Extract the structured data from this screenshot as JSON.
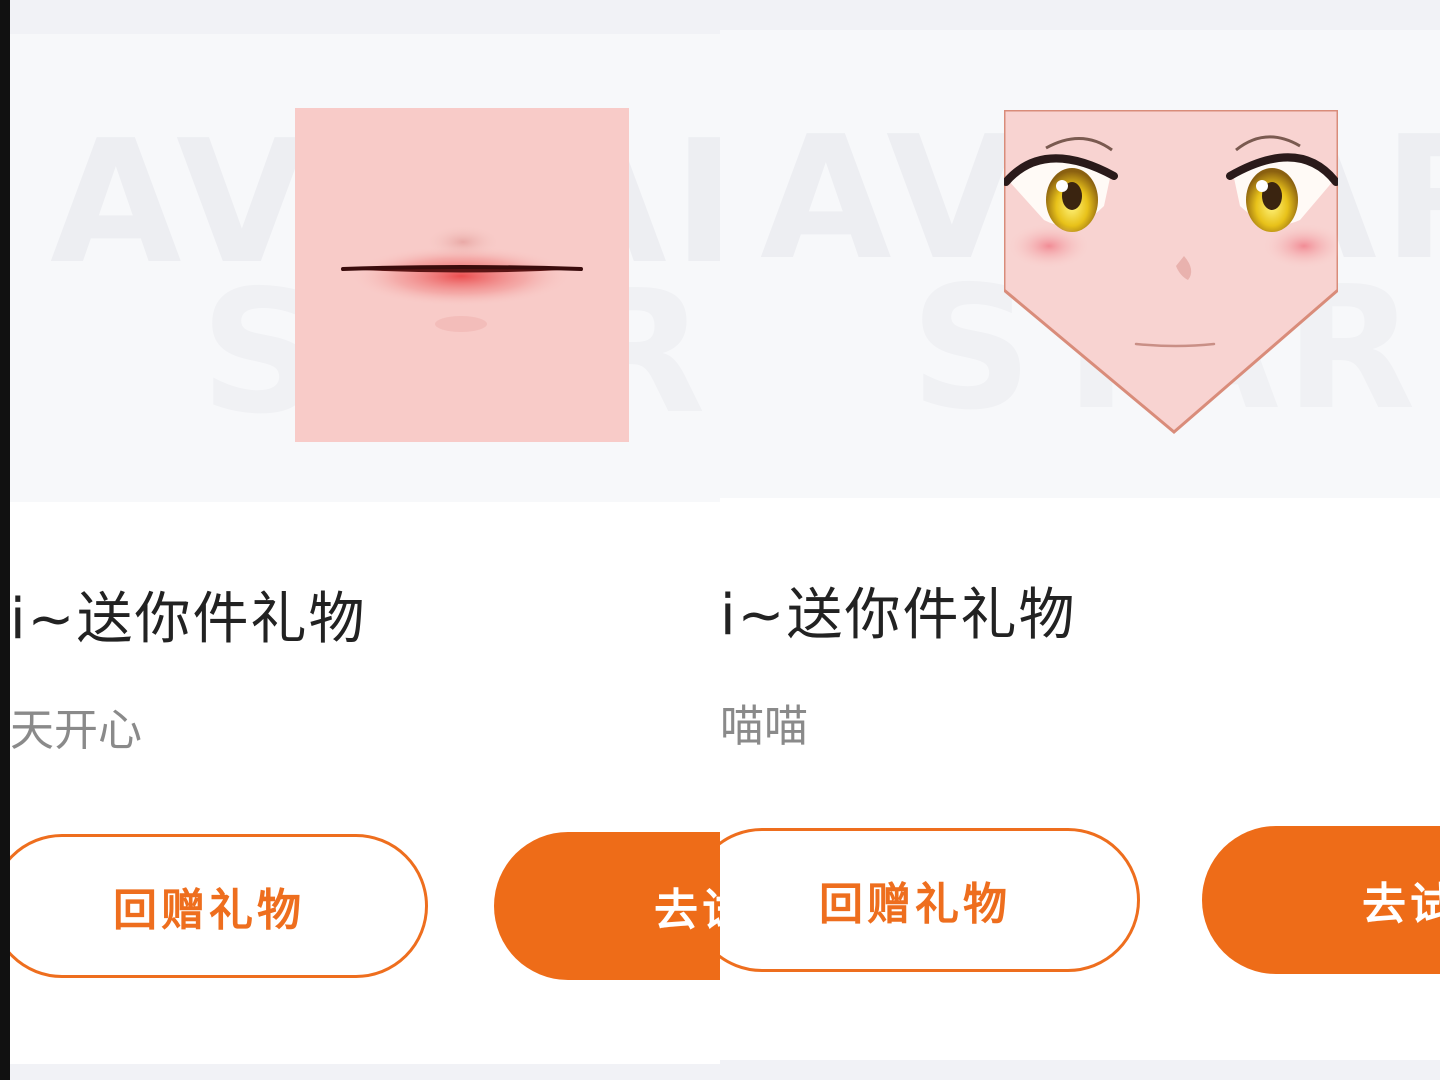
{
  "watermark": {
    "line1": "AVATAR",
    "line2": "STAR"
  },
  "cards": [
    {
      "item": "lips",
      "title": "i~送你件礼物",
      "subtitle": "天开心",
      "return_gift_label": "回赠礼物",
      "go_label": "去试"
    },
    {
      "item": "anime-face",
      "title": "i~送你件礼物",
      "subtitle": "喵喵",
      "return_gift_label": "回赠礼物",
      "go_label": "去试"
    }
  ],
  "colors": {
    "accent": "#ee6c18",
    "title": "#222222",
    "subtitle": "#8a8a8a"
  }
}
